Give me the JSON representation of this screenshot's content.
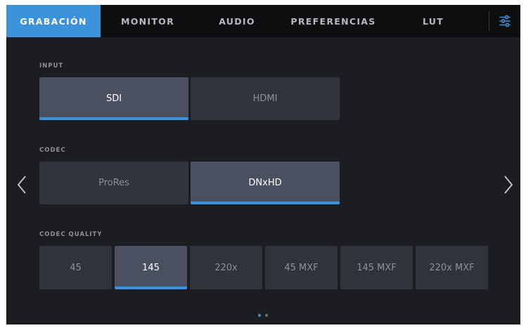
{
  "tabs": [
    {
      "label": "GRABACIÓN",
      "active": true
    },
    {
      "label": "MONITOR",
      "active": false
    },
    {
      "label": "AUDIO",
      "active": false
    },
    {
      "label": "PREFERENCIAS",
      "active": false
    },
    {
      "label": "LUT",
      "active": false
    }
  ],
  "settings_icon": "sliders-icon",
  "input": {
    "label": "INPUT",
    "options": [
      "SDI",
      "HDMI"
    ],
    "selected": "SDI"
  },
  "codec": {
    "label": "CODEC",
    "options": [
      "ProRes",
      "DNxHD"
    ],
    "selected": "DNxHD"
  },
  "codec_quality": {
    "label": "CODEC QUALITY",
    "options": [
      "45",
      "145",
      "220x",
      "45 MXF",
      "145 MXF",
      "220x MXF"
    ],
    "selected": "145"
  },
  "pagination": {
    "total": 2,
    "current": 1
  },
  "colors": {
    "accent": "#3d92dc",
    "background": "#1c1d21",
    "tabbar": "#0e0e10"
  }
}
